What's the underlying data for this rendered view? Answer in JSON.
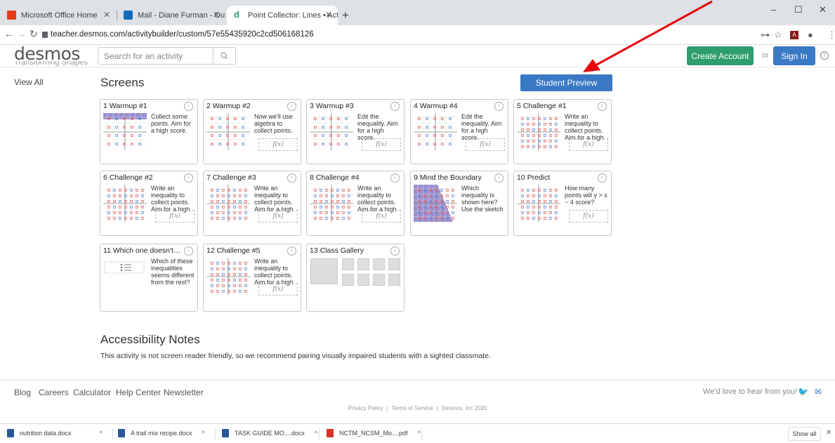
{
  "browser": {
    "tabs": [
      {
        "title": "Microsoft Office Home",
        "fav": "#e43e1c"
      },
      {
        "title": "Mail - Diane Furman - Outlook",
        "fav": "#0f6cbd"
      },
      {
        "title": "Point Collector: Lines • Activity B",
        "fav": "#2f9e6f"
      }
    ],
    "url": "teacher.desmos.com/activitybuilder/custom/57e55435920c2cd506168126",
    "icons": [
      "key-icon",
      "star-icon",
      "pdf-icon",
      "profile-icon",
      "menu-icon"
    ]
  },
  "header": {
    "logo": "desmos",
    "search_placeholder": "Search for an activity",
    "create_account": "Create Account",
    "or": "or",
    "sign_in": "Sign In"
  },
  "sidebar": {
    "cutoff_text": "Transforming Shapes",
    "view_all": "View All"
  },
  "main": {
    "screens_title": "Screens",
    "student_preview": "Student Preview",
    "cards": [
      {
        "title": "1 Warmup #1",
        "desc": "Collect some points. Aim for a high score.",
        "fx": false
      },
      {
        "title": "2 Warmup #2",
        "desc": "Now we'll use algebra to collect points.",
        "fx": true
      },
      {
        "title": "3 Warmup #3",
        "desc": "Edit the inequality. Aim for a high score.",
        "fx": true
      },
      {
        "title": "4 Warmup #4",
        "desc": "Edit the inequality. Aim for a high score.",
        "fx": true
      },
      {
        "title": "5 Challenge #1",
        "desc": "Write an inequality to collect points. Aim for a high score.",
        "fx": true
      },
      {
        "title": "6 Challenge #2",
        "desc": "Write an inequality to collect points. Aim for a high score.",
        "fx": true
      },
      {
        "title": "7 Challenge #3",
        "desc": "Write an inequality to collect points. Aim for a high score.",
        "fx": true
      },
      {
        "title": "8 Challenge #4",
        "desc": "Write an inequality to collect points. Aim for a high score.",
        "fx": true
      },
      {
        "title": "9 Mind the Boundary",
        "desc": "Which inequality is shown here? Use the sketch",
        "fx": false
      },
      {
        "title": "10 Predict",
        "desc": "How many points will y > x − 4 score?",
        "fx": true
      },
      {
        "title": "11 Which one doesn't b...",
        "desc": "Which of these inequalities seems different from the rest?",
        "fx": false
      },
      {
        "title": "12 Challenge #5",
        "desc": "Write an inequality to collect points. Aim for a high score.",
        "fx": true
      },
      {
        "title": "13 Class Gallery",
        "desc": "",
        "fx": false
      }
    ],
    "fx_label": "f(x)",
    "accessibility_title": "Accessibility Notes",
    "accessibility_text": "This activity is not screen reader friendly, so we recommend pairing visually impaired students with a sighted classmate."
  },
  "footer": {
    "links": [
      "Blog",
      "Careers",
      "Calculator",
      "Help Center",
      "Newsletter"
    ],
    "feedback": "We'd love to hear from you!",
    "privacy": "Privacy Policy",
    "terms": "Terms of Service",
    "copyright": "Desmos, Inc 2020"
  },
  "downloads": {
    "items": [
      {
        "name": "nutrition data.docx",
        "color": "#2b579a"
      },
      {
        "name": "A trail mix recipe.docx",
        "color": "#2b579a"
      },
      {
        "name": "TASK GUIDE MO....docx",
        "color": "#2b579a"
      },
      {
        "name": "NCTM_NCSM_Mo....pdf",
        "color": "#d93025"
      }
    ],
    "show_all": "Show all"
  },
  "colors": {
    "accent_blue": "#3a79c4",
    "accent_green": "#2f9e6f",
    "annotation_arrow": "#e8000b"
  }
}
